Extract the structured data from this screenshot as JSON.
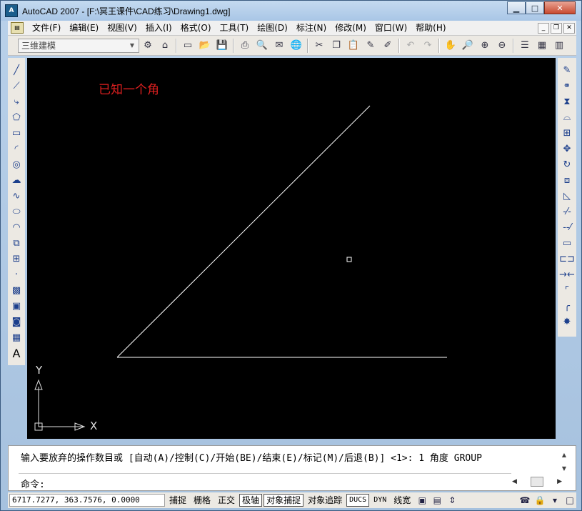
{
  "window": {
    "title": "AutoCAD 2007 - [F:\\冥王课件\\CAD练习\\Drawing1.dwg]",
    "app_icon_label": "A",
    "minimize_glyph": "▁",
    "maximize_glyph": "□",
    "close_glyph": "✕"
  },
  "menu": {
    "items": [
      "文件(F)",
      "编辑(E)",
      "视图(V)",
      "插入(I)",
      "格式(O)",
      "工具(T)",
      "绘图(D)",
      "标注(N)",
      "修改(M)",
      "窗口(W)",
      "帮助(H)"
    ],
    "doc_minimize": "_",
    "doc_restore": "❐",
    "doc_close": "✕"
  },
  "toolbar": {
    "workspace": "三维建模",
    "icons": [
      "new-icon",
      "open-icon",
      "save-icon",
      "print-icon",
      "preview-icon",
      "publish-icon",
      "plot-icon",
      "cut-icon",
      "copy-icon",
      "paste-icon",
      "match-properties-icon",
      "block-editor-icon",
      "undo-icon",
      "redo-icon",
      "pan-icon",
      "zoom-realtime-icon",
      "zoom-window-icon",
      "zoom-previous-icon",
      "properties-icon",
      "design-center-icon",
      "tool-palettes-icon"
    ]
  },
  "left_tools": [
    "line-icon",
    "construction-line-icon",
    "polyline-icon",
    "polygon-icon",
    "rectangle-icon",
    "arc-icon",
    "circle-icon",
    "revision-cloud-icon",
    "spline-icon",
    "ellipse-icon",
    "ellipse-arc-icon",
    "insert-block-icon",
    "make-block-icon",
    "point-icon",
    "hatch-icon",
    "gradient-icon",
    "region-icon",
    "table-icon",
    "multiline-text-icon"
  ],
  "left_text_tool": "A",
  "right_tools": [
    "erase-icon",
    "copy-object-icon",
    "mirror-icon",
    "offset-icon",
    "array-icon",
    "move-icon",
    "rotate-icon",
    "scale-icon",
    "stretch-icon",
    "trim-icon",
    "extend-icon",
    "break-at-point-icon",
    "break-icon",
    "join-icon",
    "chamfer-icon",
    "fillet-icon",
    "explode-icon"
  ],
  "canvas": {
    "annotation": "已知一个角",
    "ucs_x": "X",
    "ucs_y": "Y",
    "colors": {
      "background": "#000000",
      "lines": "#ffffff",
      "annotation": "#e02020"
    }
  },
  "command": {
    "history": "输入要放弃的操作数目或 [自动(A)/控制(C)/开始(BE)/结束(E)/标记(M)/后退(B)] <1>: 1 角度 GROUP",
    "prompt": "命令:"
  },
  "status": {
    "coordinates": "6717.7277, 363.7576, 0.0000",
    "buttons": [
      {
        "label": "捕捉",
        "on": false
      },
      {
        "label": "栅格",
        "on": false
      },
      {
        "label": "正交",
        "on": false
      },
      {
        "label": "极轴",
        "on": true
      },
      {
        "label": "对象捕捉",
        "on": true
      },
      {
        "label": "对象追踪",
        "on": false
      },
      {
        "label": "DUCS",
        "on": true
      },
      {
        "label": "DYN",
        "on": false
      },
      {
        "label": "线宽",
        "on": false
      }
    ],
    "tray_icons": [
      "model-icon",
      "layout-icon",
      "communication-center-icon",
      "lock-icon",
      "clean-screen-icon"
    ]
  }
}
